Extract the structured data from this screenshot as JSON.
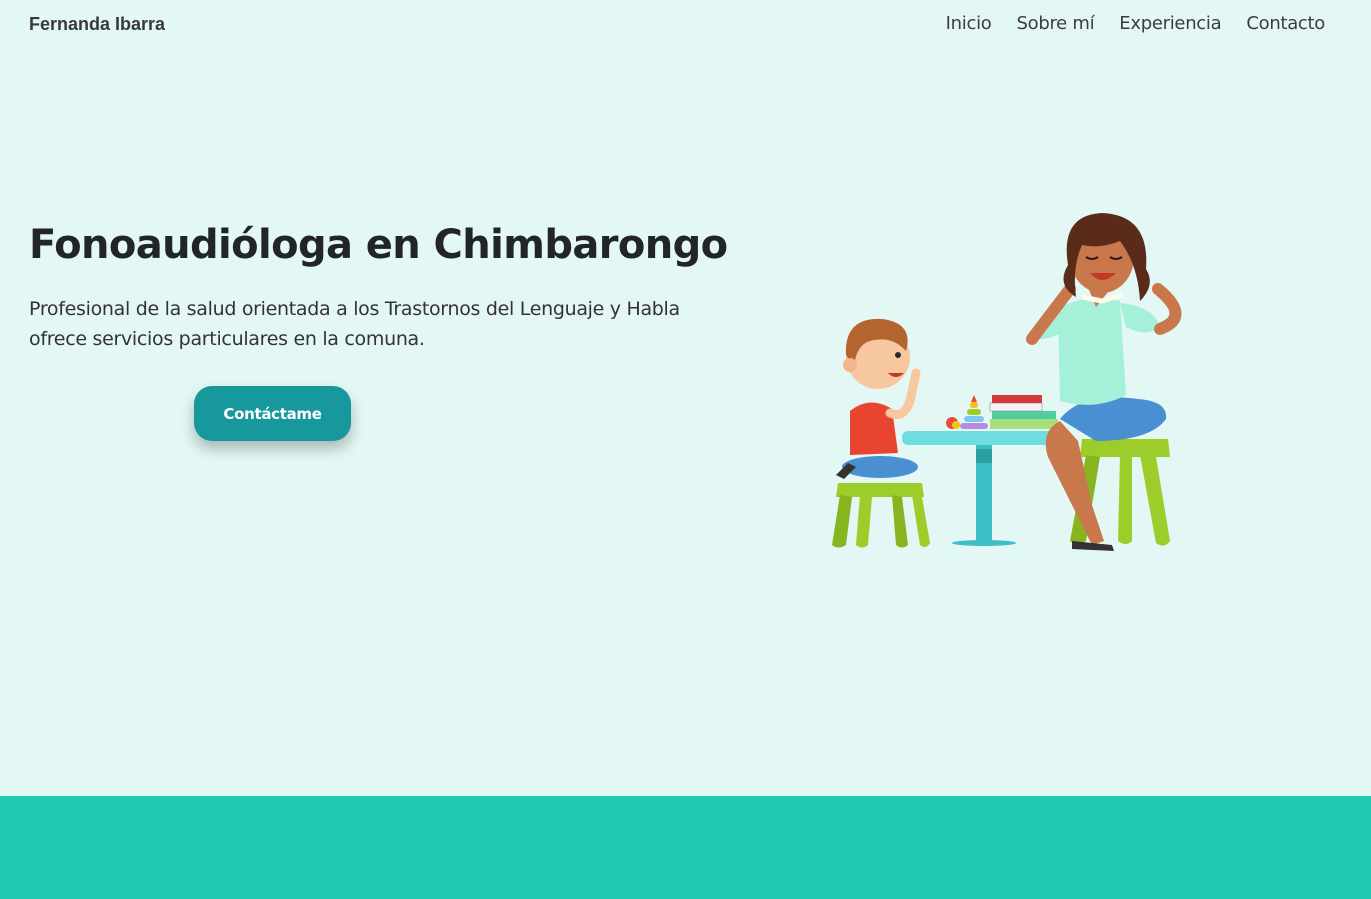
{
  "navbar": {
    "brand": "Fernanda Ibarra",
    "links": [
      "Inicio",
      "Sobre mí",
      "Experiencia",
      "Contacto"
    ]
  },
  "hero": {
    "title": "Fonoaudióloga en Chimbarongo",
    "text": "Profesional de la salud orientada a los Trastornos del Lenguaje y Habla ofrece servicios particulares en la comuna.",
    "button": "Contáctame",
    "illustration_icon": "speech-therapy-illustration"
  },
  "colors": {
    "background": "#e3f7f4",
    "accent": "#17989c",
    "band": "#22cab3"
  }
}
